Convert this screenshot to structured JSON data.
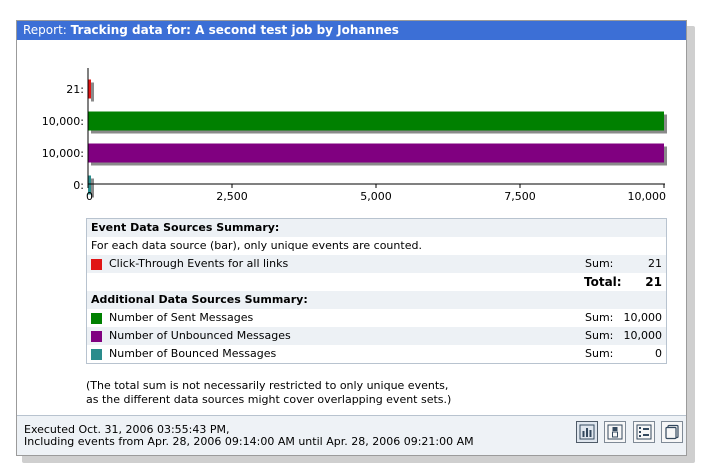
{
  "header": {
    "prefix": "Report:",
    "title": "Tracking data for: A second test job by Johannes"
  },
  "chart_data": {
    "type": "bar",
    "orientation": "horizontal",
    "categories": [
      "21:",
      "10,000:",
      "10,000:",
      "0:"
    ],
    "values": [
      21,
      10000,
      10000,
      0
    ],
    "colors": [
      "#e01515",
      "#008000",
      "#800080",
      "#2a8c8c"
    ],
    "xlim": [
      0,
      10000
    ],
    "xticks": [
      "0",
      "2,500",
      "5,000",
      "7,500",
      "10,000"
    ],
    "xtick_values": [
      0,
      2500,
      5000,
      7500,
      10000
    ],
    "grid": false
  },
  "summary": {
    "event_heading": "Event Data Sources Summary:",
    "event_note": "For each data source (bar), only unique events are counted.",
    "event_rows": [
      {
        "color": "#e01515",
        "label": "Click-Through Events for all links",
        "sum_label": "Sum:",
        "sum": "21"
      }
    ],
    "total_label": "Total:",
    "total_value": "21",
    "additional_heading": "Additional Data Sources Summary:",
    "additional_rows": [
      {
        "color": "#008000",
        "label": "Number of Sent Messages",
        "sum_label": "Sum:",
        "sum": "10,000"
      },
      {
        "color": "#800080",
        "label": "Number of Unbounced Messages",
        "sum_label": "Sum:",
        "sum": "10,000"
      },
      {
        "color": "#2a8c8c",
        "label": "Number of Bounced Messages",
        "sum_label": "Sum:",
        "sum": "0"
      }
    ]
  },
  "note": {
    "line1": "(The total sum is not necessarily restricted to only unique events,",
    "line2": "as the different data sources might cover overlapping event sets.)"
  },
  "footer": {
    "executed": "Executed Oct. 31, 2006 03:55:43 PM,",
    "range": "Including events from Apr. 28, 2006 09:14:00 AM until Apr. 28, 2006 09:21:00 AM"
  },
  "view_buttons": [
    {
      "icon": "bar-chart-icon",
      "active": true
    },
    {
      "icon": "stacked-chart-icon",
      "active": false
    },
    {
      "icon": "line-chart-icon",
      "active": false
    },
    {
      "icon": "table-view-icon",
      "active": false
    }
  ]
}
